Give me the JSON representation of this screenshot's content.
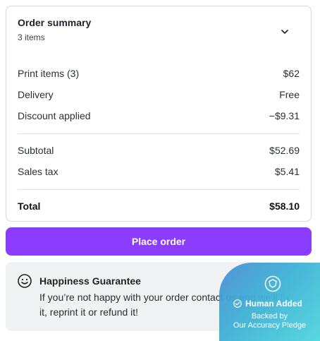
{
  "summary": {
    "title": "Order summary",
    "subtitle": "3 items",
    "rows": [
      {
        "label": "Print items (3)",
        "value": "$62"
      },
      {
        "label": "Delivery",
        "value": "Free"
      },
      {
        "label": "Discount applied",
        "value": "−$9.31"
      }
    ],
    "rows2": [
      {
        "label": "Subtotal",
        "value": "$52.69"
      },
      {
        "label": "Sales tax",
        "value": "$5.41"
      }
    ],
    "total": {
      "label": "Total",
      "value": "$58.10"
    }
  },
  "place_order": {
    "label": "Place order",
    "color": "#8b3dff"
  },
  "guarantee": {
    "title": "Happiness Guarantee",
    "text": "If you’re not happy with your order contact us and we’ll fix it, reprint it or refund it!"
  },
  "badge": {
    "line1": "Human Added",
    "line2": "Backed by",
    "line3": "Our Accuracy Pledge"
  },
  "icons": [
    "chevron-down-icon",
    "smile-icon",
    "shield-icon",
    "check-circle-icon"
  ]
}
